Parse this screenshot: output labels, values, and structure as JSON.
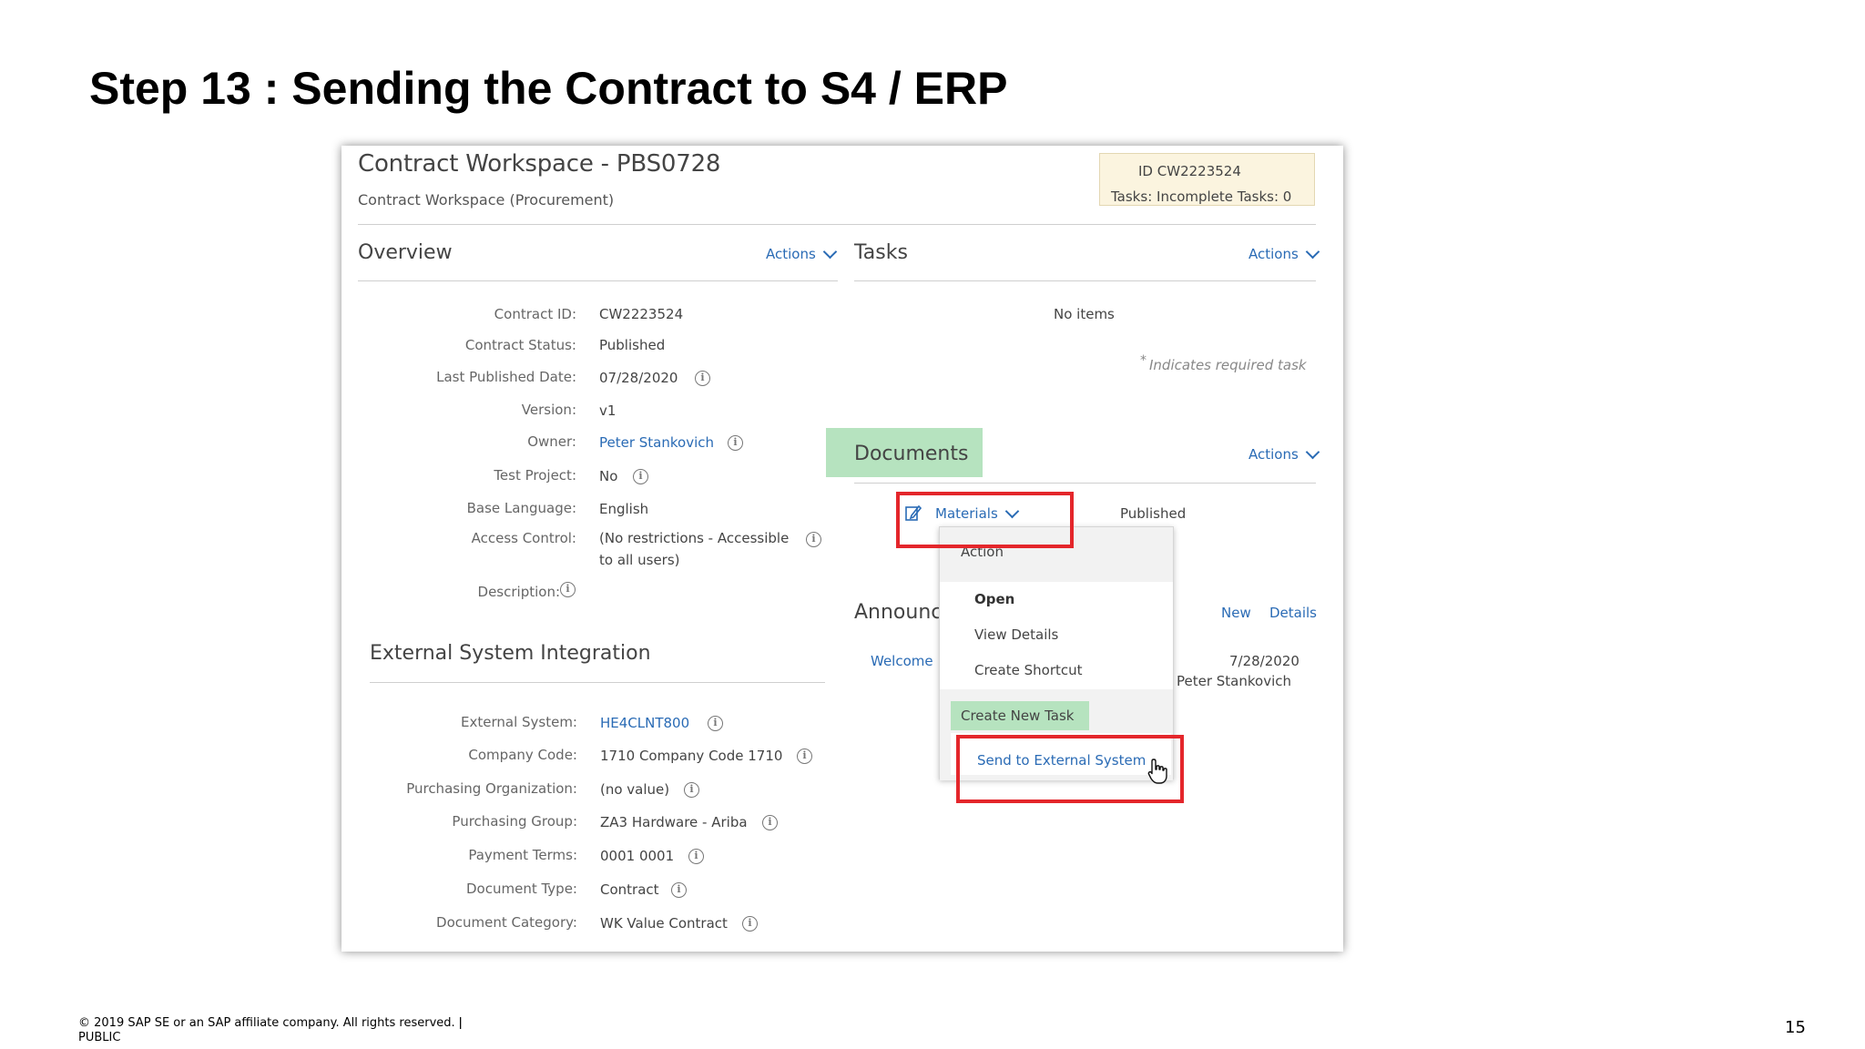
{
  "slide": {
    "title": "Step 13 : Sending the Contract to S4 / ERP",
    "footer_line1": "© 2019 SAP SE or an SAP affiliate company. All rights reserved. ǀ",
    "footer_line2": "PUBLIC",
    "page_number": "15"
  },
  "workspace": {
    "title": "Contract Workspace - PBS0728",
    "subtitle": "Contract Workspace (Procurement)",
    "id_label": "ID",
    "id_value": "CW2223524",
    "tasks_label": "Tasks:",
    "tasks_value": "Incomplete Tasks: 0"
  },
  "overview": {
    "heading": "Overview",
    "actions_label": "Actions",
    "fields": [
      {
        "label": "Contract ID:",
        "value": "CW2223524"
      },
      {
        "label": "Contract Status:",
        "value": "Published"
      },
      {
        "label": "Last Published Date:",
        "value": "07/28/2020"
      },
      {
        "label": "Version:",
        "value": "v1"
      },
      {
        "label": "Owner:",
        "value": "Peter Stankovich"
      },
      {
        "label": "Test Project:",
        "value": "No"
      },
      {
        "label": "Base Language:",
        "value": "English"
      },
      {
        "label": "Access Control:",
        "value": "(No restrictions - Accessible",
        "value2": "to all users)"
      },
      {
        "label": "Description:",
        "value": ""
      }
    ]
  },
  "external": {
    "heading": "External System Integration",
    "fields": [
      {
        "label": "External System:",
        "value": "HE4CLNT800"
      },
      {
        "label": "Company Code:",
        "value": "1710 Company Code 1710"
      },
      {
        "label": "Purchasing Organization:",
        "value": "(no value)"
      },
      {
        "label": "Purchasing Group:",
        "value": "ZA3 Hardware - Ariba"
      },
      {
        "label": "Payment Terms:",
        "value": "0001 0001"
      },
      {
        "label": "Document Type:",
        "value": "Contract"
      },
      {
        "label": "Document Category:",
        "value": "WK Value Contract"
      }
    ]
  },
  "tasks": {
    "heading": "Tasks",
    "actions_label": "Actions",
    "empty_text": "No items",
    "note_star": "*",
    "note": "Indicates required task"
  },
  "documents": {
    "heading": "Documents",
    "actions_label": "Actions",
    "doc_name": "Materials",
    "doc_status": "Published"
  },
  "announcements": {
    "heading": "Announce",
    "new_label": "New",
    "details_label": "Details",
    "item_title": "Welcome",
    "item_date": "7/28/2020",
    "item_author": "Peter Stankovich"
  },
  "menu": {
    "header": "Action",
    "items": [
      "Open",
      "View Details",
      "Create Shortcut"
    ],
    "create_task": "Create New Task",
    "send_external": "Send to External System"
  },
  "colors": {
    "link": "#2a6bb5",
    "highlight_green": "#b6e3bf",
    "callout_red": "#e4262b",
    "id_box_bg": "#fbf4df"
  }
}
